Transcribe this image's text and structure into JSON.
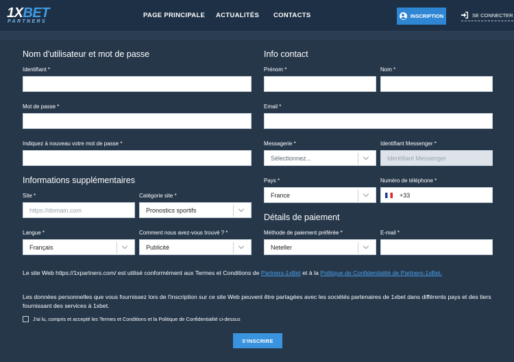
{
  "header": {
    "logo": {
      "main_1": "1X",
      "main_2": "BET",
      "sub": "PARTNERS"
    },
    "nav": [
      "PAGE PRINCIPALE",
      "ACTUALITÉS",
      "CONTACTS"
    ],
    "register_label": "INSCRIPTION",
    "login_label": "SE CONNECTER"
  },
  "account": {
    "title": "Nom d'utilisateur et mot de passe",
    "identifier_label": "Identifiant *",
    "identifier_value": "",
    "password_label": "Mot de passe *",
    "password_value": "",
    "password_repeat_label": "Indiquez à nouveau votre mot de passe *",
    "password_repeat_value": ""
  },
  "additional": {
    "title": "Informations supplémentaires",
    "site_label": "Site *",
    "site_placeholder": "https://domain.com",
    "category_label": "Catégorie site *",
    "category_value": "Pronostics sportifs",
    "language_label": "Langue *",
    "language_value": "Français",
    "found_label": "Comment nous avez-vous trouvé ? *",
    "found_value": "Publicité"
  },
  "contact": {
    "title": "Info contact",
    "firstname_label": "Prénom *",
    "firstname_value": "",
    "lastname_label": "Nom *",
    "lastname_value": "",
    "email_label": "Email *",
    "email_value": "",
    "messenger_label": "Messagerie *",
    "messenger_value": "Sélectionnez...",
    "messenger_id_label": "Identifiant Messenger *",
    "messenger_id_placeholder": "Identifiant Messenger",
    "country_label": "Pays *",
    "country_value": "France",
    "phone_label": "Numéro de téléphone *",
    "phone_prefix": "+33"
  },
  "payment": {
    "title": "Détails de paiement",
    "method_label": "Méthode de paiement préférée *",
    "method_value": "Neteller",
    "email_label": "E-mail *",
    "email_value": ""
  },
  "legal": {
    "p1_start": "Le site Web https://1xpartners.com/ est utilisé conformément aux Termes et Conditions de ",
    "p1_link1": "Partners-1xBet",
    "p1_mid": " et à la ",
    "p1_link2": "Politique de Confidentialité de Partners-1xBet.",
    "p2": "Les données personnelles que vous fournissez lors de l'inscription sur ce site Web peuvent être partagées avec les sociétés partenaires de 1xbet dans différents pays et des tiers fournissant des services à 1xbet.",
    "checkbox_label": "J'ai lu, compris et accepté les Termes et Conditions et la Politique de Confidentialité ci-dessus",
    "submit_label": "S'INSCRIRE"
  },
  "colors": {
    "header_bg": "#1d3045",
    "page_bg": "#27384b",
    "accent": "#2f86d3",
    "link": "#4aa1ec"
  }
}
